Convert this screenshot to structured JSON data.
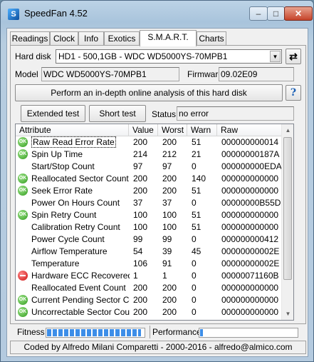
{
  "window": {
    "title": "SpeedFan 4.52",
    "min_glyph": "–",
    "max_glyph": "□",
    "close_glyph": "✕",
    "app_icon_glyph": "S"
  },
  "tabs": [
    "Readings",
    "Clock",
    "Info",
    "Exotics",
    "S.M.A.R.T.",
    "Charts"
  ],
  "active_tab": "S.M.A.R.T.",
  "hard_disk": {
    "label": "Hard disk",
    "value": "HD1 - 500,1GB - WDC WD5000YS-70MPB1"
  },
  "model": {
    "label": "Model",
    "value": "WDC WD5000YS-70MPB1"
  },
  "firmware": {
    "label": "Firmware",
    "value": "09.02E09"
  },
  "analysis_button": "Perform an in-depth online analysis of this hard disk",
  "help_glyph": "?",
  "refresh_glyph": "⇄",
  "extended_test_button": "Extended test",
  "short_test_button": "Short test",
  "status": {
    "label": "Status",
    "value": "no error"
  },
  "table": {
    "columns": [
      "Attribute",
      "Value",
      "Worst",
      "Warn",
      "Raw"
    ],
    "rows": [
      {
        "icon": "ok",
        "attribute": "Raw Read Error Rate",
        "value": "200",
        "worst": "200",
        "warn": "51",
        "raw": "000000000014",
        "selected": true
      },
      {
        "icon": "ok",
        "attribute": "Spin Up Time",
        "value": "214",
        "worst": "212",
        "warn": "21",
        "raw": "00000000187A"
      },
      {
        "icon": "none",
        "attribute": "Start/Stop Count",
        "value": "97",
        "worst": "97",
        "warn": "0",
        "raw": "000000000EDA"
      },
      {
        "icon": "ok",
        "attribute": "Reallocated Sector Count",
        "value": "200",
        "worst": "200",
        "warn": "140",
        "raw": "000000000000"
      },
      {
        "icon": "ok",
        "attribute": "Seek Error Rate",
        "value": "200",
        "worst": "200",
        "warn": "51",
        "raw": "000000000000"
      },
      {
        "icon": "none",
        "attribute": "Power On Hours Count",
        "value": "37",
        "worst": "37",
        "warn": "0",
        "raw": "00000000B55D"
      },
      {
        "icon": "ok",
        "attribute": "Spin Retry Count",
        "value": "100",
        "worst": "100",
        "warn": "51",
        "raw": "000000000000"
      },
      {
        "icon": "none",
        "attribute": "Calibration Retry Count",
        "value": "100",
        "worst": "100",
        "warn": "51",
        "raw": "000000000000"
      },
      {
        "icon": "none",
        "attribute": "Power Cycle Count",
        "value": "99",
        "worst": "99",
        "warn": "0",
        "raw": "000000000412"
      },
      {
        "icon": "none",
        "attribute": "Airflow Temperature",
        "value": "54",
        "worst": "39",
        "warn": "45",
        "raw": "00000000002E"
      },
      {
        "icon": "none",
        "attribute": "Temperature",
        "value": "106",
        "worst": "91",
        "warn": "0",
        "raw": "00000000002E"
      },
      {
        "icon": "error",
        "attribute": "Hardware ECC Recovered",
        "value": "1",
        "worst": "1",
        "warn": "0",
        "raw": "00000071160B"
      },
      {
        "icon": "none",
        "attribute": "Reallocated Event Count",
        "value": "200",
        "worst": "200",
        "warn": "0",
        "raw": "000000000000"
      },
      {
        "icon": "ok",
        "attribute": "Current Pending Sector Co...",
        "value": "200",
        "worst": "200",
        "warn": "0",
        "raw": "000000000000"
      },
      {
        "icon": "ok",
        "attribute": "Uncorrectable Sector Count",
        "value": "200",
        "worst": "200",
        "warn": "0",
        "raw": "000000000000"
      }
    ]
  },
  "fitness": {
    "label": "Fitness",
    "level_fraction": 0.97
  },
  "performance": {
    "label": "Performance",
    "level_fraction": 0.03
  },
  "footer_text": "Coded by Alfredo Milani Comparetti - 2000-2016 - alfredo@almico.com",
  "colors": {
    "ok_green": "#2f9a1c",
    "error_red": "#cc1010",
    "bar_blue": "#3d8ee8"
  }
}
